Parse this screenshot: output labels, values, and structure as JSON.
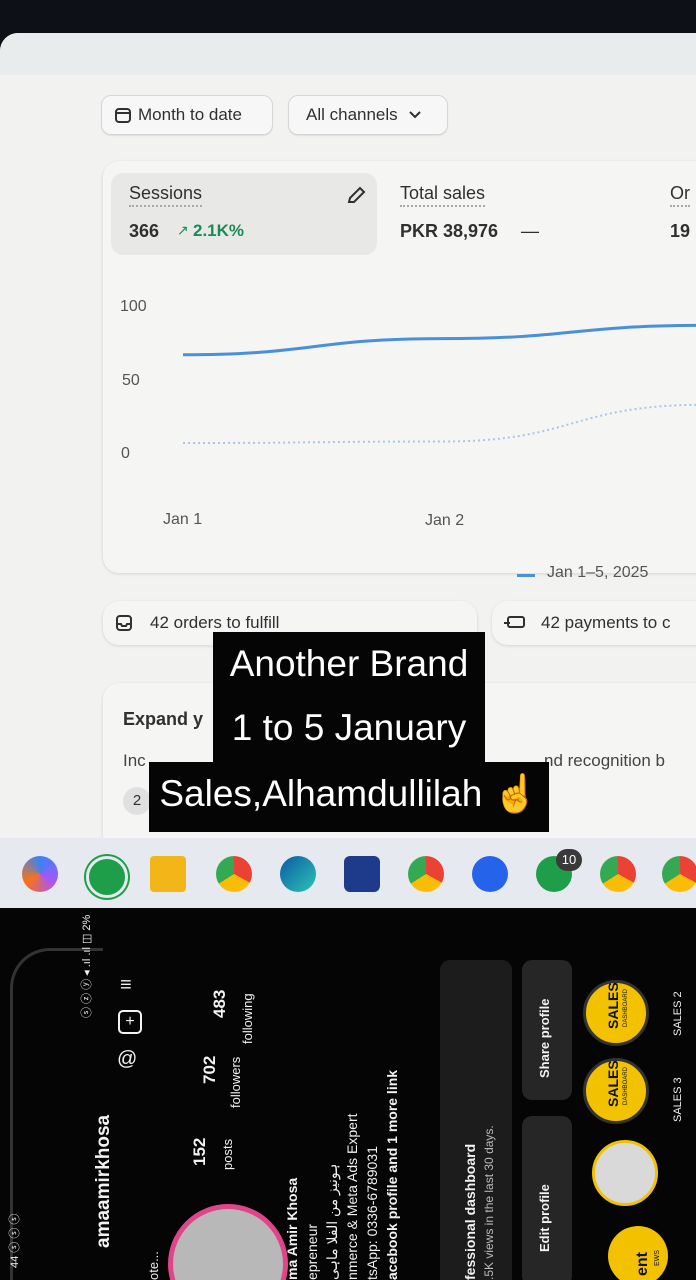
{
  "filters": {
    "date_range": "Month to date",
    "channels": "All channels"
  },
  "metrics": {
    "sessions": {
      "label": "Sessions",
      "value": "366",
      "trend": "2.1K%"
    },
    "total_sales": {
      "label": "Total sales",
      "value": "PKR 38,976",
      "trend": "—"
    },
    "orders": {
      "label": "Or",
      "value": "19"
    }
  },
  "chart_data": {
    "type": "line",
    "x": [
      "Jan 1",
      "Jan 2"
    ],
    "y_ticks": [
      "100",
      "50",
      "0"
    ],
    "ylim": [
      0,
      100
    ],
    "series": [
      {
        "name": "Jan 1–5, 2025",
        "values": [
          60,
          71,
          80
        ],
        "style": "solid",
        "color": "#4a90d9"
      },
      {
        "values": [
          0,
          1,
          26
        ],
        "style": "dotted",
        "color": "#a9c6e8"
      }
    ],
    "legend": "bottom-right"
  },
  "tasks": {
    "orders": "42 orders to fulfill",
    "payments": "42 payments to c"
  },
  "expand_card": {
    "title": "Expand y",
    "text_left": "Inc",
    "text_right": "nd recognition b",
    "badge": "2"
  },
  "overlay": {
    "line1": "Another Brand",
    "line2": "1 to 5 January",
    "line3": "Sales,Alhamdullilah ☝️"
  },
  "taskbar": {
    "whatsapp_badge": "10"
  },
  "phone": {
    "status": "ⓢ ⓩ ⓨ ◂ .ıl .ıl ◫ 2%",
    "username": "amaamirkhosa",
    "posts_count": "152",
    "posts_label": "posts",
    "followers_count": "702",
    "followers_label": "followers",
    "following_count": "483",
    "following_label": "following",
    "bio1": "ma Amir Khosa",
    "bio2": "epreneur",
    "bio3": "ہونیز من الفلا ماہی",
    "bio4": "nmerce & Meta Ads Expert",
    "bio5": "tsApp: 0336-6789031",
    "bio6": "acebook profile and 1 more link",
    "pro_dash": "fessional dashboard",
    "pro_views": ".5K views in the last 30 days.",
    "edit_profile": "Edit profile",
    "share_profile": "Share profile",
    "story_sales": "SALES",
    "story_sales2": "SALES 2",
    "story_sales3": "SALES 3",
    "story_sub": "DASHBOARD",
    "story_ent": "ent",
    "story_ews": "EWS",
    "note": "ote...",
    "time": "44 ⓢ ⓢ ⓢ"
  }
}
